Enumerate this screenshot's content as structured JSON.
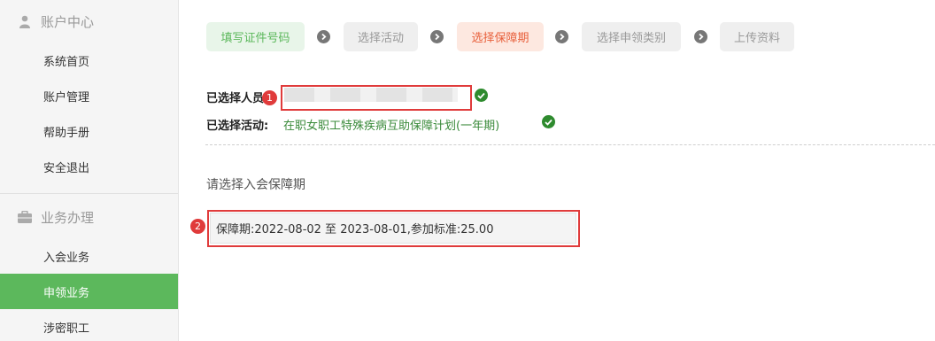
{
  "sidebar": {
    "section1": {
      "title": "账户中心",
      "icon": "user-icon"
    },
    "section1_items": [
      "系统首页",
      "账户管理",
      "帮助手册",
      "安全退出"
    ],
    "section2": {
      "title": "业务办理",
      "icon": "briefcase-icon"
    },
    "section2_items": [
      "入会业务",
      "申领业务",
      "涉密职工"
    ],
    "active_item": "申领业务"
  },
  "steps": [
    {
      "label": "填写证件号码",
      "state": "done"
    },
    {
      "label": "选择活动",
      "state": "pending"
    },
    {
      "label": "选择保障期",
      "state": "current"
    },
    {
      "label": "选择申领类别",
      "state": "pending"
    },
    {
      "label": "上传资料",
      "state": "pending"
    }
  ],
  "selected": {
    "person_label": "已选择人员",
    "activity_label": "已选择活动:",
    "activity_value": "在职女职工特殊疾病互助保障计划(一年期)"
  },
  "prompt": "请选择入会保障期",
  "period_option": "保障期:2022-08-02 至 2023-08-01,参加标准:25.00",
  "annotations": [
    "1",
    "2"
  ],
  "colors": {
    "accent_green": "#5cb85c",
    "current_orange": "#e8603c",
    "annotation_red": "#e03b3b"
  }
}
